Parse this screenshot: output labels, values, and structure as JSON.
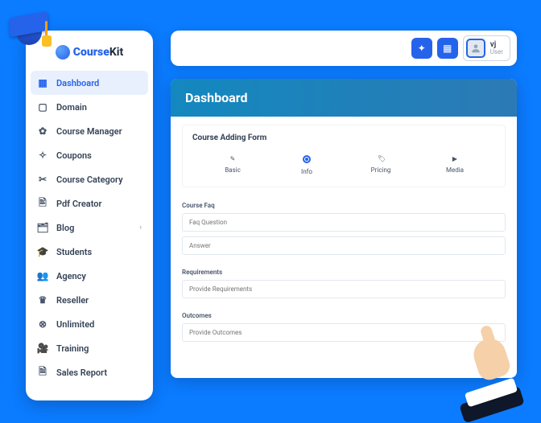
{
  "brand": {
    "name_a": "Course",
    "name_b": "Kit"
  },
  "sidebar": {
    "items": [
      {
        "label": "Dashboard",
        "icon": "▦",
        "active": true
      },
      {
        "label": "Domain",
        "icon": "▢"
      },
      {
        "label": "Course Manager",
        "icon": "✿"
      },
      {
        "label": "Coupons",
        "icon": "✧"
      },
      {
        "label": "Course Category",
        "icon": "✂"
      },
      {
        "label": "Pdf Creator",
        "icon": "🖹"
      },
      {
        "label": "Blog",
        "icon": "🗂",
        "expandable": true
      },
      {
        "label": "Students",
        "icon": "🎓"
      },
      {
        "label": "Agency",
        "icon": "👥"
      },
      {
        "label": "Reseller",
        "icon": "♛"
      },
      {
        "label": "Unlimited",
        "icon": "⊗"
      },
      {
        "label": "Training",
        "icon": "🎥"
      },
      {
        "label": "Sales Report",
        "icon": "🗎"
      }
    ]
  },
  "topbar": {
    "user": {
      "name": "vj",
      "role": "User"
    }
  },
  "main": {
    "title": "Dashboard",
    "form_title": "Course Adding Form",
    "steps": [
      {
        "label": "Basic",
        "icon": "✎"
      },
      {
        "label": "Info",
        "active": true
      },
      {
        "label": "Pricing",
        "icon": "🏷"
      },
      {
        "label": "Media",
        "icon": "▶"
      }
    ],
    "faq": {
      "heading": "Course Faq",
      "q_placeholder": "Faq Question",
      "a_placeholder": "Answer"
    },
    "requirements": {
      "heading": "Requirements",
      "placeholder": "Provide Requirements"
    },
    "outcomes": {
      "heading": "Outcomes",
      "placeholder": "Provide Outcomes"
    }
  }
}
